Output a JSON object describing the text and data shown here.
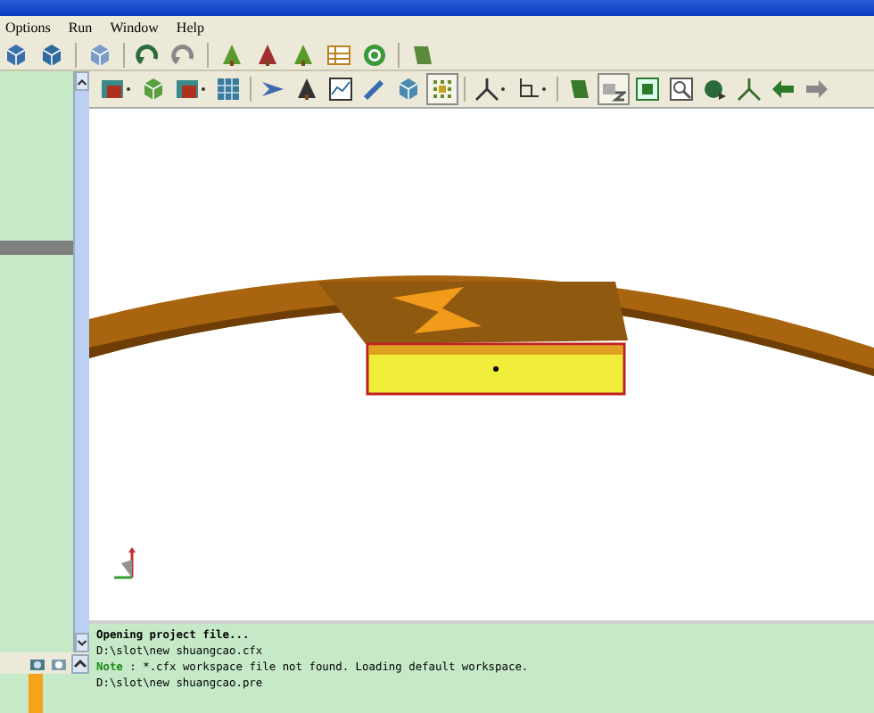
{
  "menu": [
    {
      "label": "Options"
    },
    {
      "label": "Run"
    },
    {
      "label": "Window"
    },
    {
      "label": "Help"
    }
  ],
  "log": [
    {
      "kind": "heading",
      "text": "Opening project file..."
    },
    {
      "kind": "path",
      "text": "D:\\slot\\new shuangcao.cfx"
    },
    {
      "kind": "note",
      "label": "Note",
      "text": ": *.cfx workspace file not found. Loading default workspace."
    },
    {
      "kind": "path",
      "text": "D:\\slot\\new shuangcao.pre"
    }
  ]
}
